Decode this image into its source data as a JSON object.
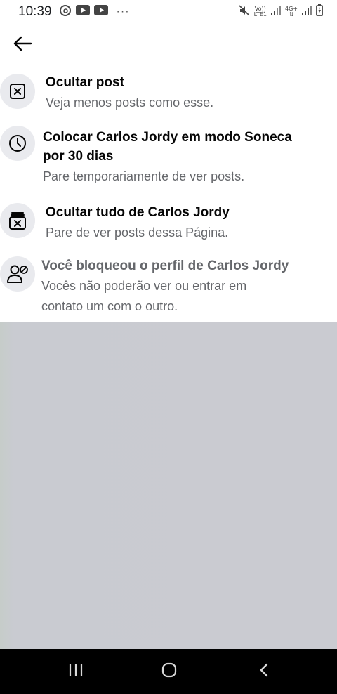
{
  "status_bar": {
    "time": "10:39",
    "dots": "···",
    "volte": "Vo))",
    "lte": "LTE1",
    "fourg": "4G+"
  },
  "header": {
    "back_icon": "arrow-left-icon"
  },
  "menu": {
    "items": [
      {
        "icon": "hide-post-icon",
        "title": "Ocultar post",
        "subtitle": "Veja menos posts como esse."
      },
      {
        "icon": "clock-icon",
        "title_line1": "Colocar Carlos Jordy em modo Soneca",
        "title_line2": "por 30 dias",
        "subtitle": "Pare temporariamente de ver posts."
      },
      {
        "icon": "hide-all-icon",
        "title": "Ocultar tudo de Carlos Jordy",
        "subtitle": "Pare de ver posts dessa Página."
      },
      {
        "icon": "blocked-profile-icon",
        "title": "Você bloqueou o perfil de Carlos Jordy",
        "subtitle_line1": "Vocês não poderão ver ou entrar em",
        "subtitle_line2": "contato um com o outro."
      }
    ]
  },
  "nav_bar": {
    "buttons": [
      "recent-apps-icon",
      "home-icon",
      "back-icon"
    ]
  }
}
